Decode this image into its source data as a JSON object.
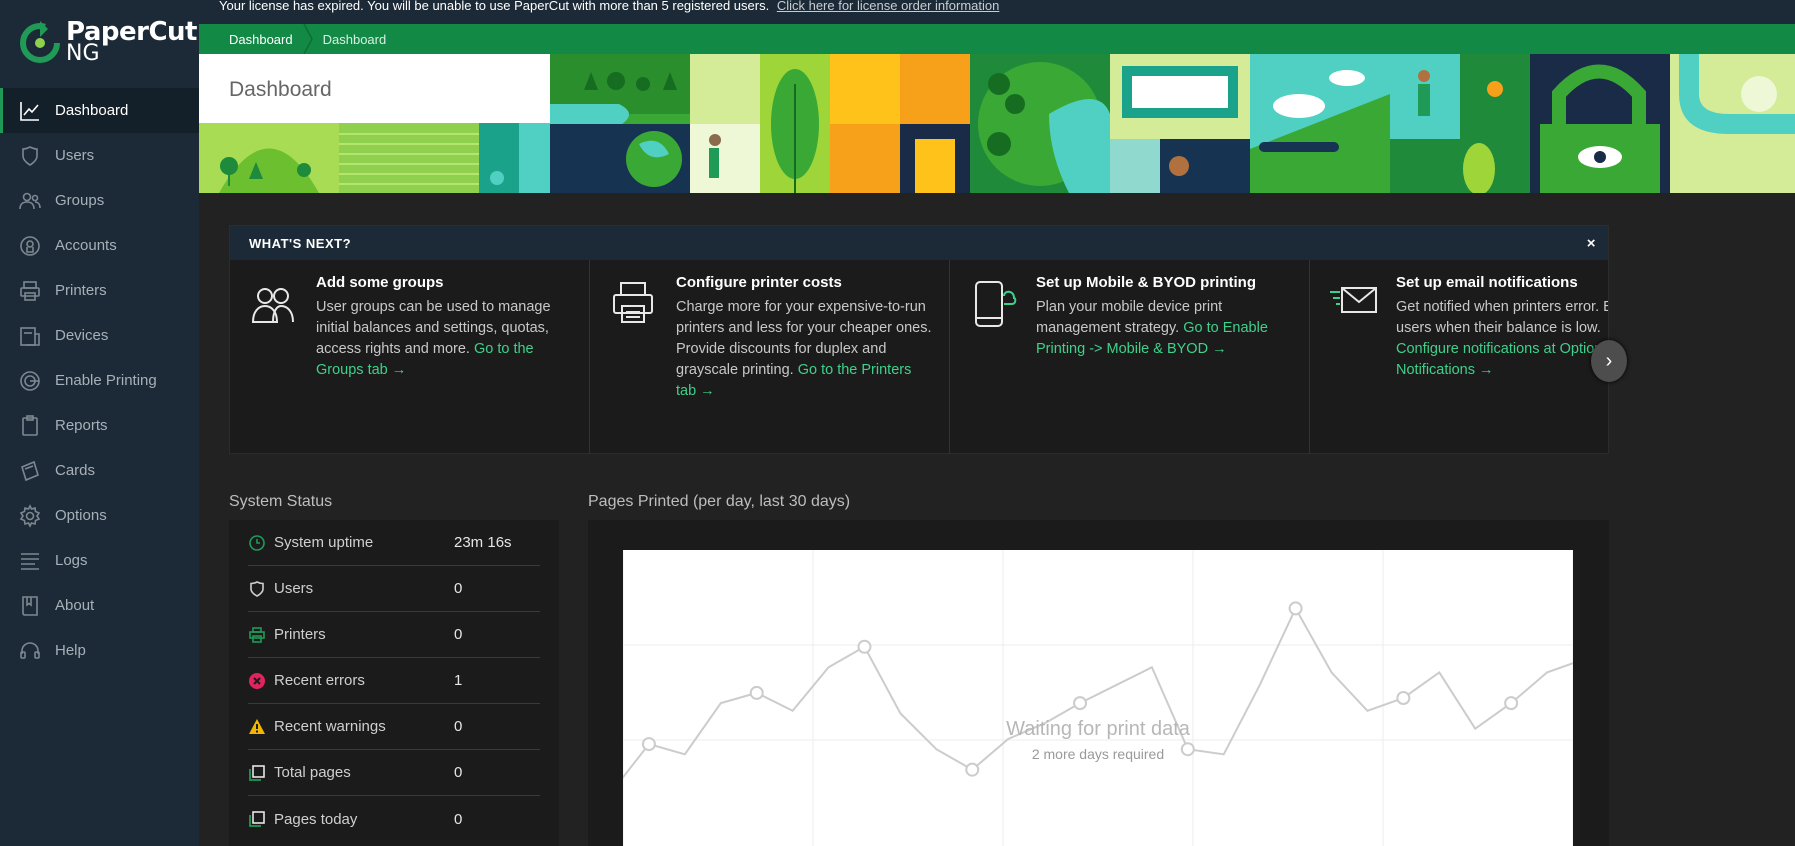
{
  "topbar": {
    "notice": "Your license has expired. You will be unable to use PaperCut with more than 5 registered users.",
    "link": "Click here for license order information"
  },
  "logo": {
    "name": "PaperCut",
    "sub": "NG"
  },
  "breadcrumb": {
    "first": "Dashboard",
    "second": "Dashboard"
  },
  "banner": {
    "title": "Dashboard"
  },
  "nav": [
    {
      "label": "Dashboard",
      "icon": "chart-line-icon"
    },
    {
      "label": "Users",
      "icon": "user-shield-icon"
    },
    {
      "label": "Groups",
      "icon": "users-icon"
    },
    {
      "label": "Accounts",
      "icon": "accounts-icon"
    },
    {
      "label": "Printers",
      "icon": "printer-icon"
    },
    {
      "label": "Devices",
      "icon": "device-icon"
    },
    {
      "label": "Enable Printing",
      "icon": "radar-icon"
    },
    {
      "label": "Reports",
      "icon": "clipboard-icon"
    },
    {
      "label": "Cards",
      "icon": "card-icon"
    },
    {
      "label": "Options",
      "icon": "gear-icon"
    },
    {
      "label": "Logs",
      "icon": "lines-icon"
    },
    {
      "label": "About",
      "icon": "book-icon"
    },
    {
      "label": "Help",
      "icon": "headset-icon"
    }
  ],
  "whats_next": {
    "title": "WHAT'S NEXT?",
    "close": "×",
    "cards": [
      {
        "title": "Add some groups",
        "text": "User groups can be used to manage initial balances and settings, quotas, access rights and more.",
        "link": "Go to the Groups tab →",
        "icon": "groups-icon"
      },
      {
        "title": "Configure printer costs",
        "text": "Charge more for your expensive-to-run printers and less for your cheaper ones. Provide discounts for duplex and grayscale printing.",
        "link": "Go to the Printers tab →",
        "icon": "printer-icon"
      },
      {
        "title": "Set up Mobile & BYOD printing",
        "text": "Plan your mobile device print management strategy.",
        "link": "Go to Enable Printing -> Mobile & BYOD →",
        "icon": "mobile-icon"
      },
      {
        "title": "Set up email notifications",
        "text": "Get notified when printers error. Email users when their balance is low.",
        "link": "Configure notifications at Options -> Notifications →",
        "icon": "email-icon"
      }
    ],
    "next": "›"
  },
  "system_status": {
    "title": "System Status",
    "rows": [
      {
        "label": "System uptime",
        "value": "23m 16s",
        "icon": "clock-icon",
        "color": "#1f9a57"
      },
      {
        "label": "Users",
        "value": "0",
        "icon": "user-shield-icon",
        "color": "#cfcfcf"
      },
      {
        "label": "Printers",
        "value": "0",
        "icon": "printer-icon",
        "color": "#1f9a57"
      },
      {
        "label": "Recent errors",
        "value": "1",
        "icon": "error-icon",
        "color": "#e0245e"
      },
      {
        "label": "Recent warnings",
        "value": "0",
        "icon": "warning-icon",
        "color": "#f5b400"
      },
      {
        "label": "Total pages",
        "value": "0",
        "icon": "pages-icon",
        "color": "#1f9a57"
      },
      {
        "label": "Pages today",
        "value": "0",
        "icon": "pages-icon",
        "color": "#1f9a57"
      }
    ]
  },
  "pages_printed": {
    "title": "Pages Printed (per day, last 30 days)",
    "waiting": "Waiting for print data",
    "more": "2 more days required"
  },
  "chart_data": {
    "type": "line",
    "values": [
      14,
      32,
      28,
      48,
      52,
      45,
      62,
      70,
      44,
      30,
      22,
      34,
      40,
      48,
      55,
      62,
      30,
      28,
      55,
      85,
      60,
      45,
      50,
      60,
      38,
      48,
      60,
      65
    ],
    "ylim": [
      0,
      100
    ]
  },
  "colors": {
    "accent": "#1f9a57",
    "sidebar": "#1c2a37",
    "link": "#3ed18a"
  }
}
